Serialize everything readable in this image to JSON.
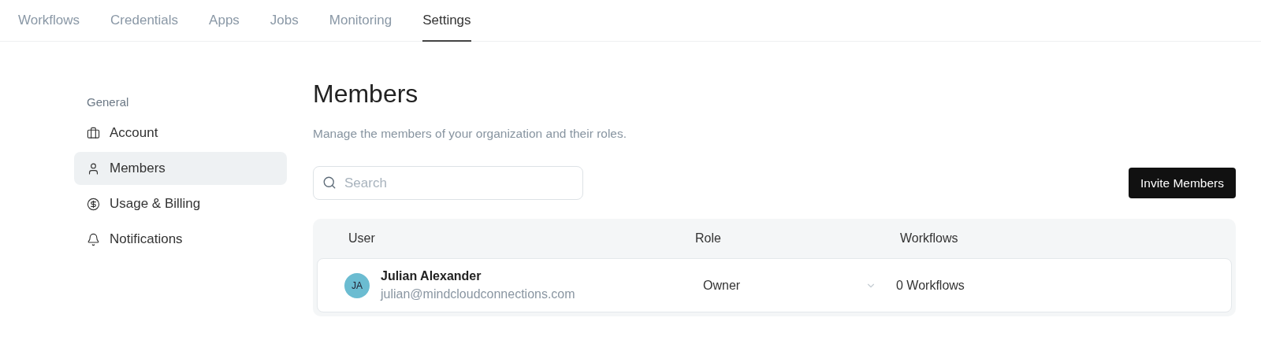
{
  "nav_tabs": [
    {
      "label": "Workflows",
      "selected": false
    },
    {
      "label": "Credentials",
      "selected": false
    },
    {
      "label": "Apps",
      "selected": false
    },
    {
      "label": "Jobs",
      "selected": false
    },
    {
      "label": "Monitoring",
      "selected": false
    },
    {
      "label": "Settings",
      "selected": true
    }
  ],
  "sidebar": {
    "heading": "General",
    "items": [
      {
        "label": "Account",
        "selected": false
      },
      {
        "label": "Members",
        "selected": true
      },
      {
        "label": "Usage & Billing",
        "selected": false
      },
      {
        "label": "Notifications",
        "selected": false
      }
    ]
  },
  "page": {
    "title": "Members",
    "subtitle": "Manage the members of your organization and their roles."
  },
  "search": {
    "placeholder": "Search"
  },
  "invite_button": "Invite Members",
  "table": {
    "columns": [
      "User",
      "Role",
      "Workflows"
    ],
    "rows": [
      {
        "initials": "JA",
        "name": "Julian Alexander",
        "email": "julian@mindcloudconnections.com",
        "role": "Owner",
        "workflows": "0 Workflows"
      }
    ]
  }
}
